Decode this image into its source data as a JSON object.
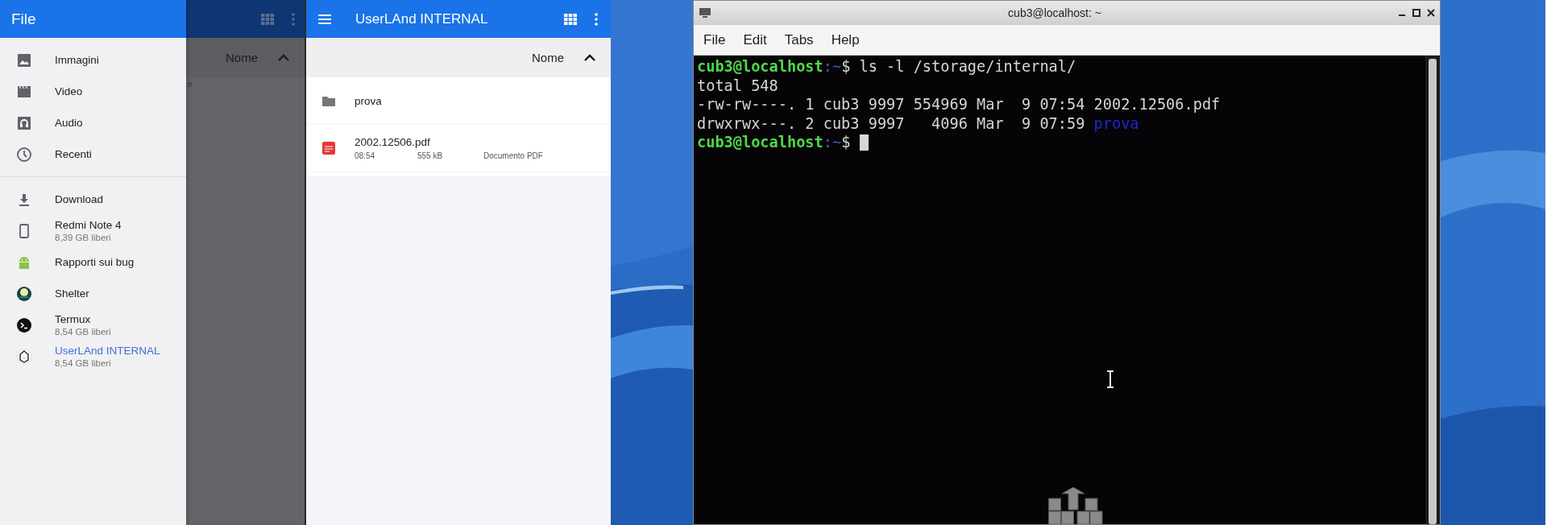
{
  "drawer_screen": {
    "appbar": {
      "title": "File"
    },
    "behind": {
      "sort_label": "Nome",
      "fragment": "e"
    },
    "drawer": {
      "sections": [
        {
          "items": [
            {
              "kind": "images",
              "label": "Immagini",
              "selected": false
            },
            {
              "kind": "video",
              "label": "Video",
              "selected": false
            },
            {
              "kind": "audio",
              "label": "Audio",
              "selected": false
            },
            {
              "kind": "recent",
              "label": "Recenti",
              "selected": false
            }
          ]
        },
        {
          "items": [
            {
              "kind": "download",
              "label": "Download",
              "selected": false
            },
            {
              "kind": "phone",
              "label": "Redmi Note 4",
              "subtitle": "8,39 GB liberi",
              "selected": false
            },
            {
              "kind": "android",
              "label": "Rapporti sui bug",
              "selected": false
            },
            {
              "kind": "shelter",
              "label": "Shelter",
              "selected": false
            },
            {
              "kind": "termux",
              "label": "Termux",
              "subtitle": "8,54 GB liberi",
              "selected": false
            },
            {
              "kind": "userland",
              "label": "UserLAnd INTERNAL",
              "subtitle": "8,54 GB liberi",
              "selected": true
            }
          ]
        }
      ]
    }
  },
  "file_screen": {
    "appbar": {
      "title": "UserLAnd INTERNAL"
    },
    "sort": {
      "label": "Nome"
    },
    "files": [
      {
        "kind": "folder",
        "name": "prova"
      },
      {
        "kind": "pdf",
        "name": "2002.12506.pdf",
        "time": "08:54",
        "size": "555 kB",
        "type": "Documento PDF"
      }
    ]
  },
  "terminal": {
    "title": "cub3@localhost: ~",
    "menu": [
      "File",
      "Edit",
      "Tabs",
      "Help"
    ],
    "lines": [
      {
        "cursor": false,
        "parts": [
          {
            "kind": "prompt",
            "text": "cub3@localhost"
          },
          {
            "kind": "path",
            "text": ":~"
          },
          {
            "kind": "plain",
            "text": "$ ls -l /storage/internal/"
          }
        ]
      },
      {
        "cursor": false,
        "parts": [
          {
            "kind": "plain",
            "text": "total 548"
          }
        ]
      },
      {
        "cursor": false,
        "parts": [
          {
            "kind": "plain",
            "text": "-rw-rw----. 1 cub3 9997 554969 Mar  9 07:54 2002.12506.pdf"
          }
        ]
      },
      {
        "cursor": false,
        "parts": [
          {
            "kind": "plain",
            "text": "drwxrwx---. 2 cub3 9997   4096 Mar  9 07:59 "
          },
          {
            "kind": "dir",
            "text": "prova"
          }
        ]
      },
      {
        "cursor": true,
        "parts": [
          {
            "kind": "prompt",
            "text": "cub3@localhost"
          },
          {
            "kind": "path",
            "text": ":~"
          },
          {
            "kind": "plain",
            "text": "$ "
          }
        ]
      }
    ]
  }
}
